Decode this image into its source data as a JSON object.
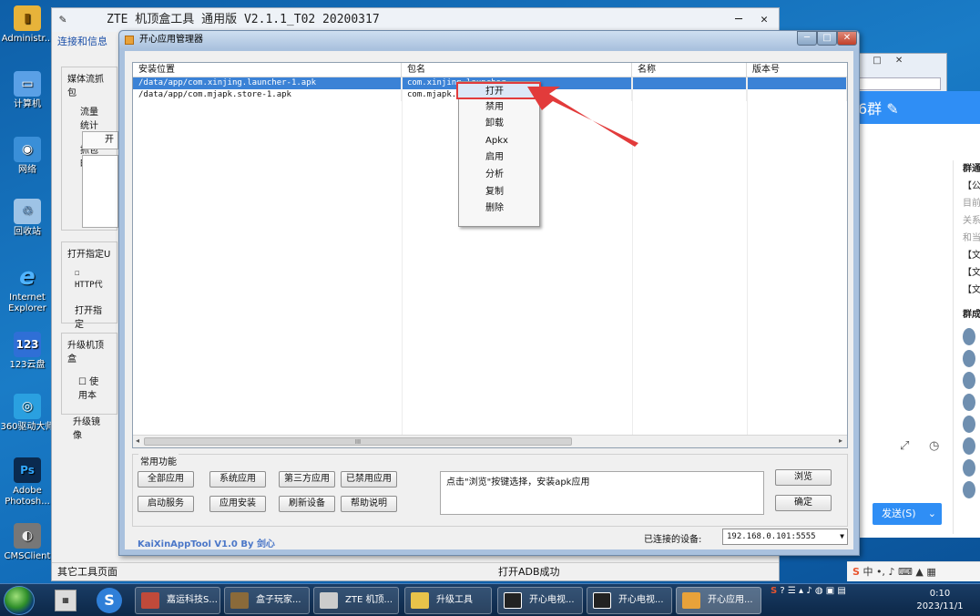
{
  "desktop": {
    "icons": [
      {
        "label": "Administr...",
        "color": "#e7b33a",
        "glyph": "▮"
      },
      {
        "label": "计算机",
        "color": "#5aa0e6",
        "glyph": "▭"
      },
      {
        "label": "网络",
        "color": "#3a8fd8",
        "glyph": "◉"
      },
      {
        "label": "回收站",
        "color": "#9ec3e6",
        "glyph": "♲"
      },
      {
        "label": "Internet Explorer",
        "color": "#2e7fd8",
        "glyph": "e"
      },
      {
        "label": "123云盘",
        "color": "#2f6fd6",
        "glyph": "123"
      },
      {
        "label": "360驱动大师",
        "color": "#2aa0e0",
        "glyph": "◎"
      },
      {
        "label": "Adobe Photosh...",
        "color": "#0a2a4f",
        "glyph": "Ps"
      },
      {
        "label": "CMSClient",
        "color": "#777777",
        "glyph": "◐"
      }
    ]
  },
  "zte_window": {
    "title": "ZTE  机顶盒工具  通用版  V2.1.1_T02  20200317",
    "menu": "连接和信息",
    "group1_label": "媒体流抓包",
    "group1_l1": "流量统计",
    "group1_l2": "抓包时长",
    "group1_btn": "开",
    "group2_label": "打开指定U",
    "group2_cb": "HTTP代",
    "group2_l": "打开指定",
    "group3_label": "升级机顶盒",
    "group3_cb": "使用本",
    "group3_l": "升级镜像",
    "status_left": "其它工具页面",
    "status_mid": "打开ADB成功"
  },
  "kx_window": {
    "title": "开心应用管理器",
    "columns": [
      "安装位置",
      "包名",
      "名称",
      "版本号"
    ],
    "rows": [
      {
        "path": "/data/app/com.xinjing.launcher-1.apk",
        "pkg": "com.xinjing.launcher",
        "name": "",
        "ver": "",
        "selected": true
      },
      {
        "path": "/data/app/com.mjapk.store-1.apk",
        "pkg": "com.mjapk.s",
        "name": "",
        "ver": "",
        "selected": false
      }
    ],
    "scroll_thumb": "III",
    "common_label": "常用功能",
    "buttons": {
      "all_apps": "全部应用",
      "system_apps": "系统应用",
      "third_apps": "第三方应用",
      "disabled_apps": "已禁用应用",
      "start_service": "启动服务",
      "install_app": "应用安装",
      "refresh": "刷新设备",
      "help": "帮助说明",
      "browse": "浏览",
      "confirm": "确定"
    },
    "hint": "点击\"浏览\"按键选择，安装apk应用",
    "brand": "KaiXinAppTool V1.0 By 剑心",
    "device_label": "已连接的设备:",
    "device_value": "192.168.0.101:5555"
  },
  "context_menu": [
    "打开",
    "禁用",
    "卸载",
    "Apkx",
    "启用",
    "分析",
    "复制",
    "删除"
  ],
  "chat": {
    "title": "6群",
    "side_items": [
      "群通",
      "【公",
      "目前",
      "关系",
      "和当",
      "【文",
      "【文",
      "【文"
    ],
    "members_label": "群成",
    "send": "发送(S)"
  },
  "taskbar": {
    "items": [
      {
        "label": "嘉运科技S...",
        "color": "#c04a3a"
      },
      {
        "label": "盒子玩家...",
        "color": "#8a6a3a"
      },
      {
        "label": "ZTE 机顶...",
        "color": "#cccccc"
      },
      {
        "label": "升级工具",
        "color": "#e8c34a"
      },
      {
        "label": "开心电视...",
        "color": "#222222"
      },
      {
        "label": "开心电视...",
        "color": "#222222"
      },
      {
        "label": "开心应用...",
        "color": "#e8a23a"
      }
    ],
    "ime": "中",
    "time": "0:10",
    "date": "2023/11/1"
  }
}
